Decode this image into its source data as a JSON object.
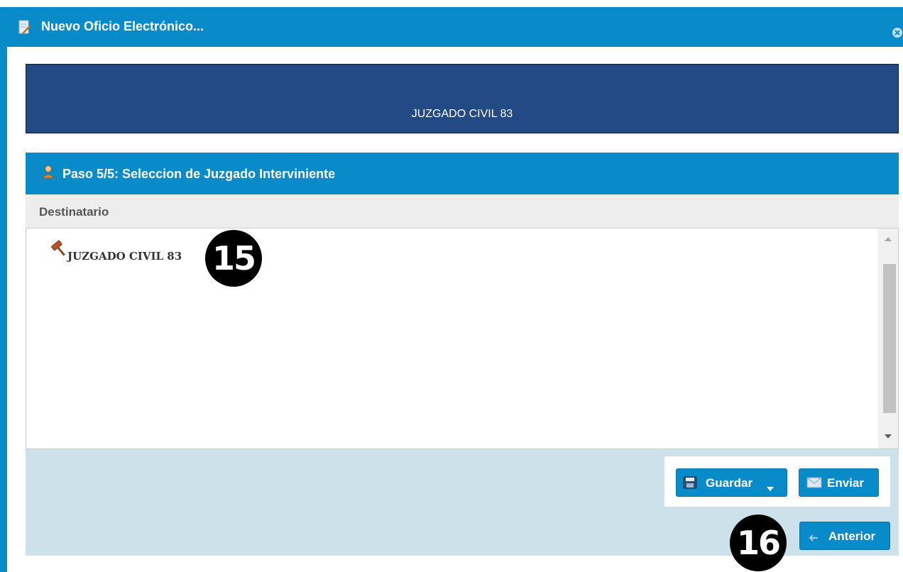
{
  "window": {
    "title": "Nuevo Oficio Electrónico..."
  },
  "header": {
    "court_name": "JUZGADO CIVIL 83"
  },
  "step_panel": {
    "title": "Paso 5/5: Seleccion de Juzgado Interviniente",
    "column_header": "Destinatario",
    "recipients": [
      {
        "label": "JUZGADO CIVIL 83"
      }
    ]
  },
  "annotations": {
    "badge_1": "15",
    "badge_2": "16"
  },
  "actions": {
    "guardar_label": "Guardar",
    "enviar_label": "Enviar",
    "anterior_label": "Anterior"
  },
  "colors": {
    "primary": "#0a8bc9",
    "banner": "#244a86",
    "footer": "#cde1ea"
  }
}
